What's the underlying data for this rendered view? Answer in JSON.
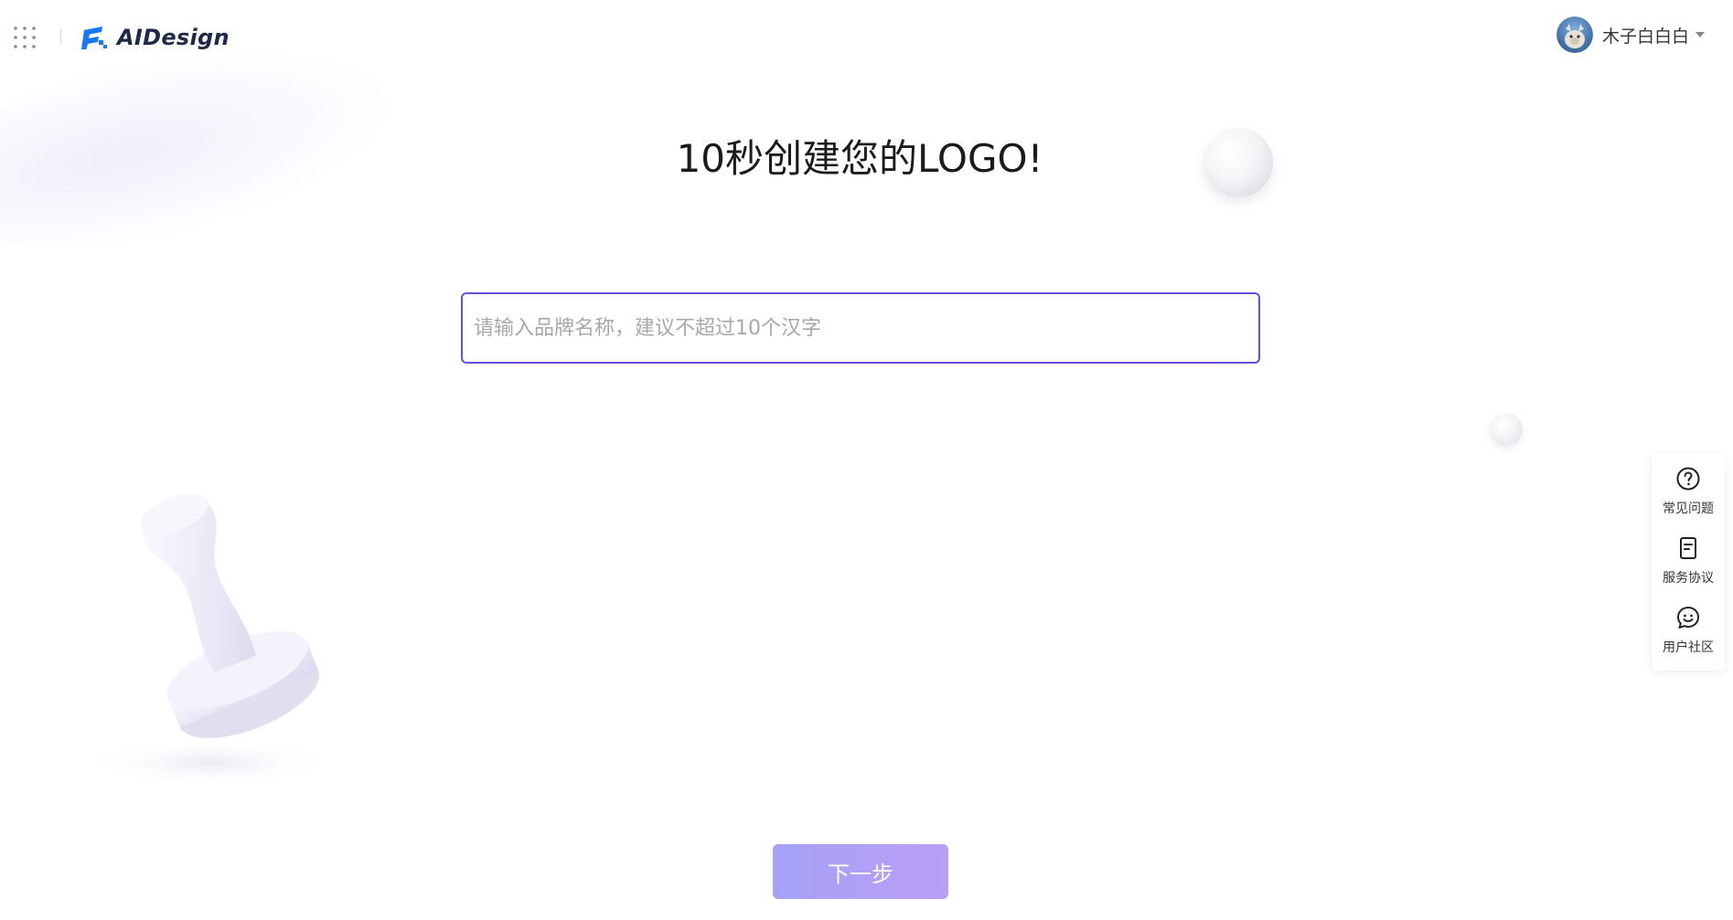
{
  "header": {
    "apps_icon": "grid-dots-icon",
    "logo_text": "AIDesign",
    "user": {
      "name": "木子白白白",
      "avatar_icon": "avatar-image",
      "dropdown_icon": "caret-down-icon"
    }
  },
  "main": {
    "title": "10秒创建您的LOGO!",
    "brand_input": {
      "value": "",
      "placeholder": "请输入品牌名称，建议不超过10个汉字"
    },
    "next_label": "下一步"
  },
  "side_panel": {
    "items": [
      {
        "label": "常见问题",
        "icon": "question-circle-icon"
      },
      {
        "label": "服务协议",
        "icon": "document-icon"
      },
      {
        "label": "用户社区",
        "icon": "smile-chat-icon"
      }
    ]
  },
  "colors": {
    "accent": "#6b4be0",
    "button_start": "#a6a2f8",
    "button_end": "#b89ef4",
    "logo_blue": "#1677ff"
  }
}
